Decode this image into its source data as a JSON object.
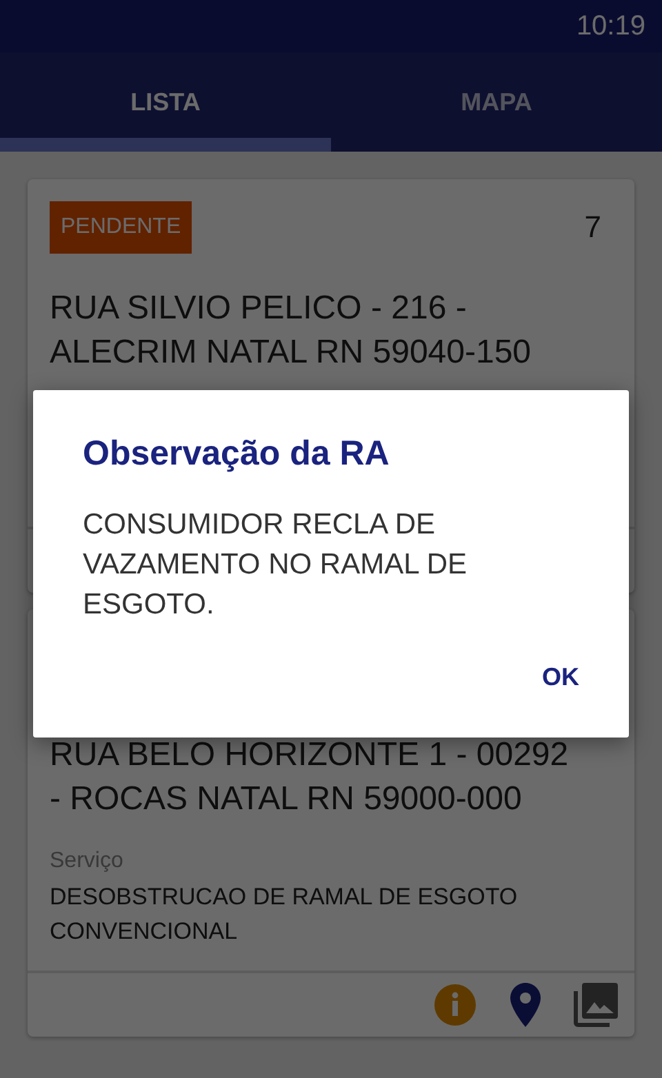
{
  "status_bar": {
    "time": "10:19"
  },
  "tabs": [
    {
      "label": "LISTA",
      "selected": true
    },
    {
      "label": "MAPA",
      "selected": false
    }
  ],
  "cards": [
    {
      "status": "PENDENTE",
      "number": "7",
      "address": "RUA SILVIO PELICO - 216 - ALECRIM NATAL RN 59040-150"
    },
    {
      "address": "RUA BELO HORIZONTE 1 - 00292 - ROCAS NATAL RN 59000-000",
      "service_label": "Serviço",
      "service": "DESOBSTRUCAO DE RAMAL DE ESGOTO CONVENCIONAL",
      "actions": [
        {
          "kind": "info"
        },
        {
          "kind": "location"
        },
        {
          "kind": "photos"
        }
      ]
    }
  ],
  "dialog": {
    "title": "Observação da RA",
    "message": "CONSUMIDOR RECLA DE VAZAMENTO NO RAMAL DE ESGOTO.",
    "button": "OK"
  }
}
